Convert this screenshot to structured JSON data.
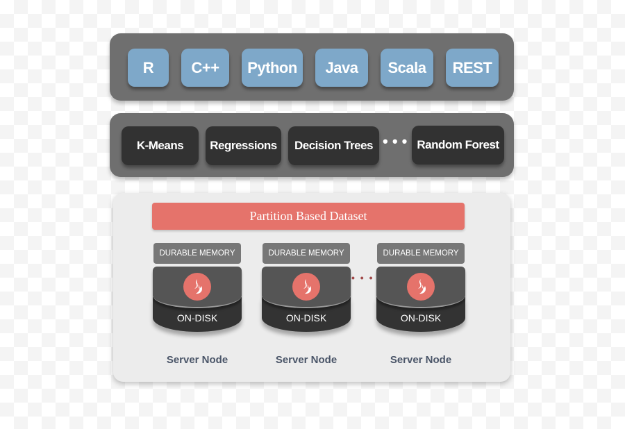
{
  "languages": [
    "R",
    "C++",
    "Python",
    "Java",
    "Scala",
    "REST"
  ],
  "algorithms": [
    "K-Means",
    "Regressions",
    "Decision Trees",
    "Random Forest"
  ],
  "ellipsis": "• • •",
  "storage": {
    "partition_label": "Partition Based Dataset",
    "nodes": [
      {
        "memory": "DURABLE MEMORY",
        "disk": "ON-DISK",
        "label": "Server Node"
      },
      {
        "memory": "DURABLE MEMORY",
        "disk": "ON-DISK",
        "label": "Server Node"
      },
      {
        "memory": "DURABLE MEMORY",
        "disk": "ON-DISK",
        "label": "Server Node"
      }
    ],
    "node_ellipsis": "• • •",
    "node_icon": "flame-icon"
  },
  "colors": {
    "language": "#7ea8c9",
    "algorithm": "#323232",
    "partition": "#e5736b"
  }
}
